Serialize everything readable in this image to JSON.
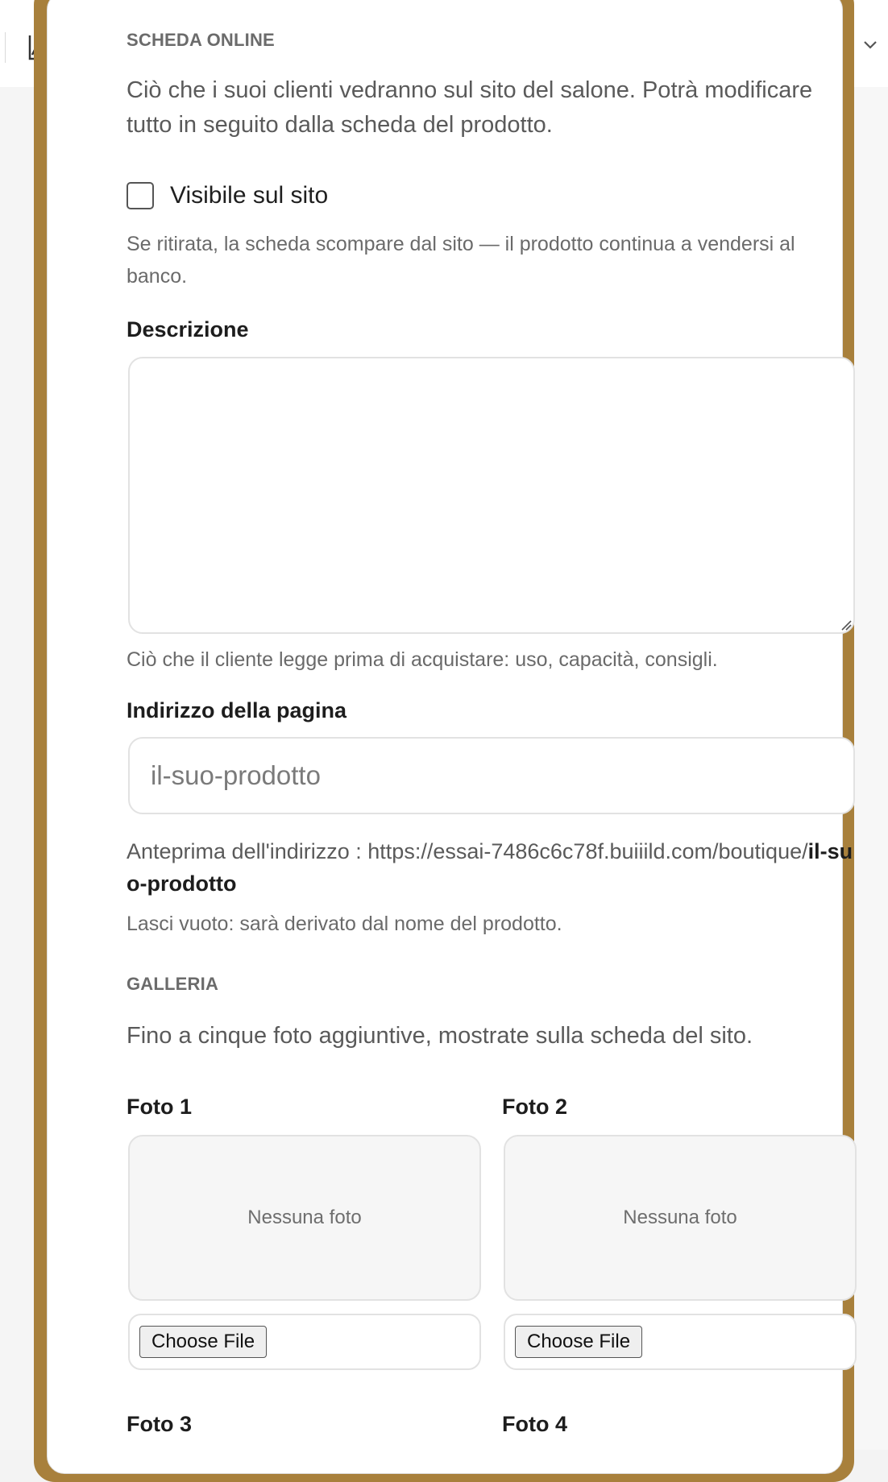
{
  "section": {
    "title": "SCHEDA ONLINE",
    "intro": "Ciò che i suoi clienti vedranno sul sito del salone. Potrà modificare tutto in seguito dalla scheda del prodotto."
  },
  "visibility": {
    "label": "Visibile sul sito",
    "checked": false,
    "hint": "Se ritirata, la scheda scompare dal sito — il prodotto continua a vendersi al banco."
  },
  "description": {
    "label": "Descrizione",
    "value": "",
    "hint": "Ciò che il cliente legge prima di acquistare: uso, capacità, consigli."
  },
  "address": {
    "label": "Indirizzo della pagina",
    "placeholder": "il-suo-prodotto",
    "value": "",
    "preview_label": "Anteprima dell'indirizzo : ",
    "preview_base": "https://essai-7486c6c78f.buiiild.com/boutique/",
    "preview_slug": "il-suo-prodotto",
    "hint": "Lasci vuoto: sarà derivato dal nome del prodotto."
  },
  "gallery": {
    "title": "GALLERIA",
    "intro": "Fino a cinque foto aggiuntive, mostrate sulla scheda del sito.",
    "empty_label": "Nessuna foto",
    "file_button": "Choose File",
    "photos": [
      {
        "label": "Foto 1"
      },
      {
        "label": "Foto 2"
      },
      {
        "label": "Foto 3"
      },
      {
        "label": "Foto 4"
      }
    ]
  },
  "colors": {
    "accent_frame": "#a8803c",
    "panel_bg": "#ffffff",
    "muted_text": "#6a6a6a"
  },
  "icons": {
    "top_left": "chart-icon",
    "top_right": "chevron-down-icon"
  }
}
